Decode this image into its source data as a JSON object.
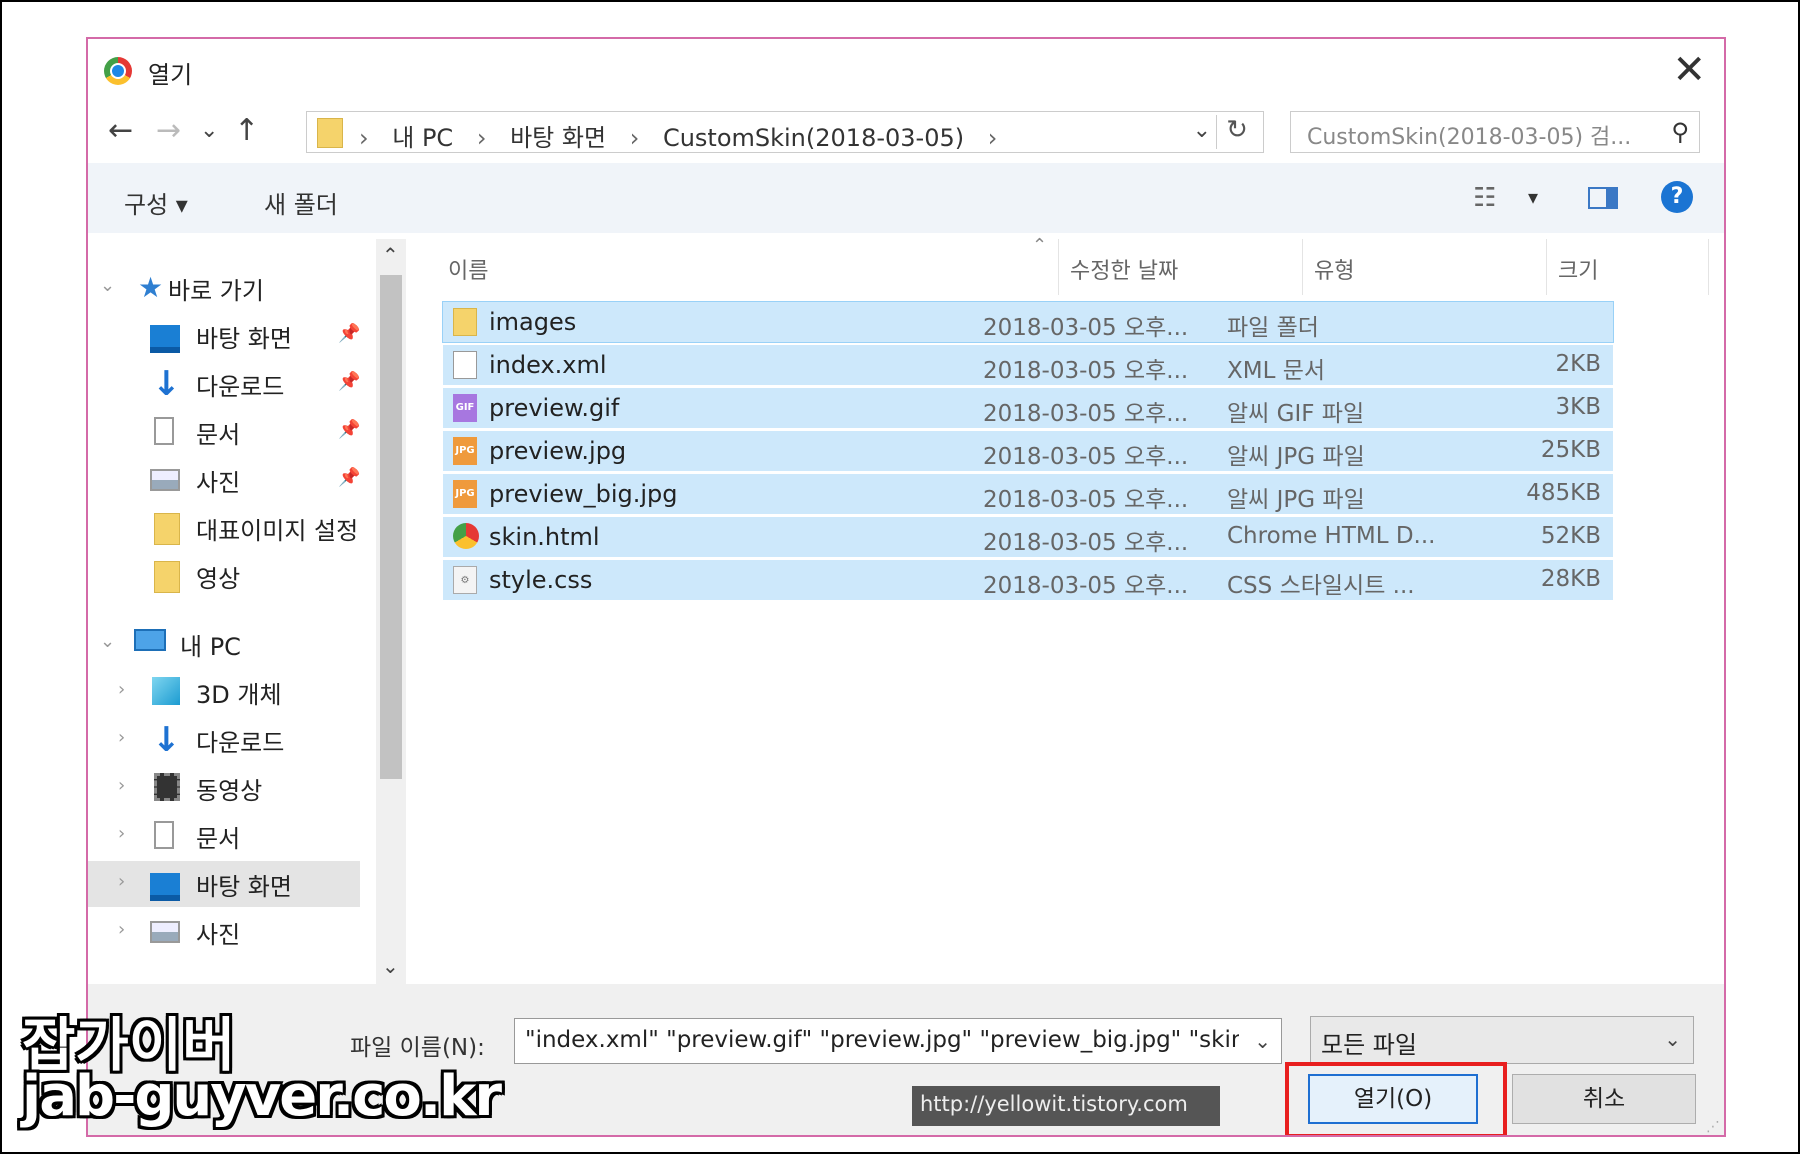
{
  "dialog": {
    "title": "열기"
  },
  "nav": {
    "back": "←",
    "forward": "→",
    "recent": "⌄",
    "up": "↑",
    "breadcrumbs": [
      "내 PC",
      "바탕 화면",
      "CustomSkin(2018-03-05)"
    ],
    "separator": "›",
    "address_dropdown": "⌄",
    "refresh": "↻"
  },
  "search": {
    "placeholder": "CustomSkin(2018-03-05) 검..."
  },
  "toolbar": {
    "organize": "구성 ▾",
    "new_folder": "새 폴더",
    "view_dropdown": "▾"
  },
  "sidebar": {
    "quick_access": "바로 가기",
    "quick_items": [
      {
        "label": "바탕 화면",
        "icon": "desktop-icon"
      },
      {
        "label": "다운로드",
        "icon": "download-icon"
      },
      {
        "label": "문서",
        "icon": "document-icon"
      },
      {
        "label": "사진",
        "icon": "pictures-icon"
      },
      {
        "label": "대표이미지 설정",
        "icon": "folder-icon"
      },
      {
        "label": "영상",
        "icon": "folder-icon"
      }
    ],
    "this_pc": "내 PC",
    "pc_items": [
      {
        "label": "3D 개체",
        "icon": "3d-objects-icon"
      },
      {
        "label": "다운로드",
        "icon": "download-icon"
      },
      {
        "label": "동영상",
        "icon": "video-icon"
      },
      {
        "label": "문서",
        "icon": "document-icon"
      },
      {
        "label": "바탕 화면",
        "icon": "desktop-icon"
      },
      {
        "label": "사진",
        "icon": "pictures-icon"
      }
    ]
  },
  "columns": {
    "name": "이름",
    "date": "수정한 날짜",
    "type": "유형",
    "size": "크기"
  },
  "files": [
    {
      "name": "images",
      "date": "2018-03-05 오후...",
      "type": "파일 폴더",
      "size": "",
      "icon": "folder-icon",
      "badge": ""
    },
    {
      "name": "index.xml",
      "date": "2018-03-05 오후...",
      "type": "XML 문서",
      "size": "2KB",
      "icon": "xml-file-icon",
      "badge": ""
    },
    {
      "name": "preview.gif",
      "date": "2018-03-05 오후...",
      "type": "알씨 GIF 파일",
      "size": "3KB",
      "icon": "gif-file-icon",
      "badge": "GIF"
    },
    {
      "name": "preview.jpg",
      "date": "2018-03-05 오후...",
      "type": "알씨 JPG 파일",
      "size": "25KB",
      "icon": "jpg-file-icon",
      "badge": "JPG"
    },
    {
      "name": "preview_big.jpg",
      "date": "2018-03-05 오후...",
      "type": "알씨 JPG 파일",
      "size": "485KB",
      "icon": "jpg-file-icon",
      "badge": "JPG"
    },
    {
      "name": "skin.html",
      "date": "2018-03-05 오후...",
      "type": "Chrome HTML D...",
      "size": "52KB",
      "icon": "chrome-html-icon",
      "badge": ""
    },
    {
      "name": "style.css",
      "date": "2018-03-05 오후...",
      "type": "CSS 스타일시트 ...",
      "size": "28KB",
      "icon": "css-file-icon",
      "badge": "⚙"
    }
  ],
  "footer": {
    "filename_label": "파일 이름(N):",
    "filename_value": "\"index.xml\" \"preview.gif\" \"preview.jpg\" \"preview_big.jpg\" \"skin.htr",
    "filetype_value": "모든 파일",
    "open_label": "열기(O)",
    "cancel_label": "취소",
    "watermark": "http://yellowit.tistory.com"
  },
  "overlay": {
    "brand_korean": "잡가이버",
    "brand_url": "jab-guyver.co.kr"
  },
  "colors": {
    "selection": "#cde8fb",
    "accent": "#1f6fd1",
    "highlight_box": "#e81f1f",
    "dialog_border": "#d46aa8"
  }
}
